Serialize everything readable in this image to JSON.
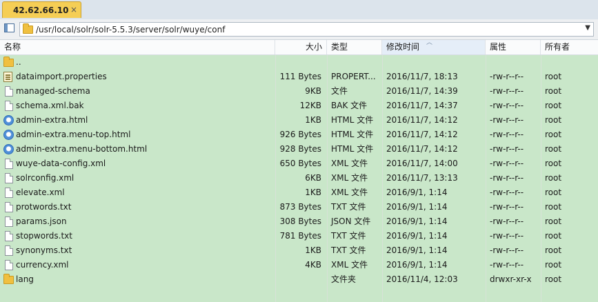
{
  "tab": {
    "label": "42.62.66.10",
    "close": "×"
  },
  "address": {
    "path": "/usr/local/solr/solr-5.5.3/server/solr/wuye/conf",
    "dropdown": "▼"
  },
  "columns": {
    "name": "名称",
    "size": "大小",
    "type": "类型",
    "modified": "修改时间",
    "perm": "属性",
    "owner": "所有者"
  },
  "sort_indicator": "︿",
  "files": [
    {
      "icon": "folder-icon",
      "name": "..",
      "size": "",
      "type": "",
      "modified": "",
      "perm": "",
      "owner": ""
    },
    {
      "icon": "properties-file-icon",
      "name": "dataimport.properties",
      "size": "111 Bytes",
      "type": "PROPERT...",
      "modified": "2016/11/7, 18:13",
      "perm": "-rw-r--r--",
      "owner": "root"
    },
    {
      "icon": "file-icon",
      "name": "managed-schema",
      "size": "9KB",
      "type": "文件",
      "modified": "2016/11/7, 14:39",
      "perm": "-rw-r--r--",
      "owner": "root"
    },
    {
      "icon": "file-icon",
      "name": "schema.xml.bak",
      "size": "12KB",
      "type": "BAK 文件",
      "modified": "2016/11/7, 14:37",
      "perm": "-rw-r--r--",
      "owner": "root"
    },
    {
      "icon": "html-file-icon",
      "name": "admin-extra.html",
      "size": "1KB",
      "type": "HTML 文件",
      "modified": "2016/11/7, 14:12",
      "perm": "-rw-r--r--",
      "owner": "root"
    },
    {
      "icon": "html-file-icon",
      "name": "admin-extra.menu-top.html",
      "size": "926 Bytes",
      "type": "HTML 文件",
      "modified": "2016/11/7, 14:12",
      "perm": "-rw-r--r--",
      "owner": "root"
    },
    {
      "icon": "html-file-icon",
      "name": "admin-extra.menu-bottom.html",
      "size": "928 Bytes",
      "type": "HTML 文件",
      "modified": "2016/11/7, 14:12",
      "perm": "-rw-r--r--",
      "owner": "root"
    },
    {
      "icon": "file-icon",
      "name": "wuye-data-config.xml",
      "size": "650 Bytes",
      "type": "XML 文件",
      "modified": "2016/11/7, 14:00",
      "perm": "-rw-r--r--",
      "owner": "root"
    },
    {
      "icon": "file-icon",
      "name": "solrconfig.xml",
      "size": "6KB",
      "type": "XML 文件",
      "modified": "2016/11/7, 13:13",
      "perm": "-rw-r--r--",
      "owner": "root"
    },
    {
      "icon": "file-icon",
      "name": "elevate.xml",
      "size": "1KB",
      "type": "XML 文件",
      "modified": "2016/9/1, 1:14",
      "perm": "-rw-r--r--",
      "owner": "root"
    },
    {
      "icon": "file-icon",
      "name": "protwords.txt",
      "size": "873 Bytes",
      "type": "TXT 文件",
      "modified": "2016/9/1, 1:14",
      "perm": "-rw-r--r--",
      "owner": "root"
    },
    {
      "icon": "file-icon",
      "name": "params.json",
      "size": "308 Bytes",
      "type": "JSON 文件",
      "modified": "2016/9/1, 1:14",
      "perm": "-rw-r--r--",
      "owner": "root"
    },
    {
      "icon": "file-icon",
      "name": "stopwords.txt",
      "size": "781 Bytes",
      "type": "TXT 文件",
      "modified": "2016/9/1, 1:14",
      "perm": "-rw-r--r--",
      "owner": "root"
    },
    {
      "icon": "file-icon",
      "name": "synonyms.txt",
      "size": "1KB",
      "type": "TXT 文件",
      "modified": "2016/9/1, 1:14",
      "perm": "-rw-r--r--",
      "owner": "root"
    },
    {
      "icon": "file-icon",
      "name": "currency.xml",
      "size": "4KB",
      "type": "XML 文件",
      "modified": "2016/9/1, 1:14",
      "perm": "-rw-r--r--",
      "owner": "root"
    },
    {
      "icon": "folder-icon",
      "name": "lang",
      "size": "",
      "type": "文件夹",
      "modified": "2016/11/4, 12:03",
      "perm": "drwxr-xr-x",
      "owner": "root"
    }
  ]
}
